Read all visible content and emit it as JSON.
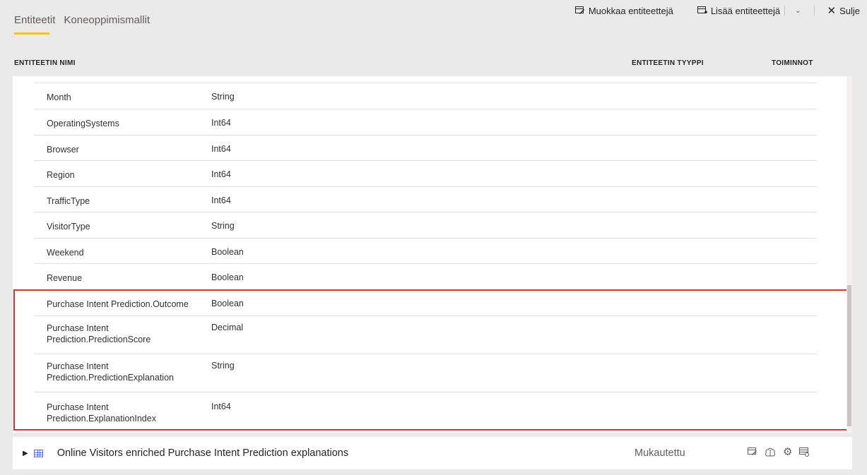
{
  "tabs": [
    {
      "label": "Entiteetit",
      "active": true
    },
    {
      "label": "Koneoppimismallit",
      "active": false
    }
  ],
  "toolbar": {
    "edit_label": "Muokkaa entiteettejä",
    "add_label": "Lisää entiteettejä",
    "close_label": "Sulje"
  },
  "columns": {
    "name": "ENTITEETIN NIMI",
    "type": "ENTITEETIN TYYPPI",
    "actions": "TOIMINNOT"
  },
  "fields": [
    {
      "name": "Month",
      "type": "String"
    },
    {
      "name": "OperatingSystems",
      "type": "Int64"
    },
    {
      "name": "Browser",
      "type": "Int64"
    },
    {
      "name": "Region",
      "type": "Int64"
    },
    {
      "name": "TrafficType",
      "type": "Int64"
    },
    {
      "name": "VisitorType",
      "type": "String"
    },
    {
      "name": "Weekend",
      "type": "Boolean"
    },
    {
      "name": "Revenue",
      "type": "Boolean"
    },
    {
      "name": "Purchase Intent Prediction.Outcome",
      "type": "Boolean"
    },
    {
      "name": "Purchase Intent\nPrediction.PredictionScore",
      "type": "Decimal"
    },
    {
      "name": "Purchase Intent\nPrediction.PredictionExplanation",
      "type": "String"
    },
    {
      "name": "Purchase Intent\nPrediction.ExplanationIndex",
      "type": "Int64"
    }
  ],
  "entity": {
    "name": "Online Visitors enriched Purchase Intent Prediction explanations",
    "type": "Mukautettu",
    "action_icons": [
      "edit-entity-icon",
      "brain-icon",
      "settings-gear-icon",
      "incremental-refresh-icon"
    ]
  },
  "colors": {
    "highlight": "#d13438",
    "tab_underline": "#f2c811"
  }
}
